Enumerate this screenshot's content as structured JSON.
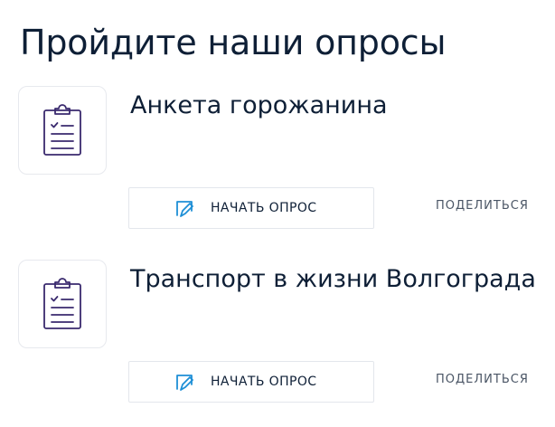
{
  "page": {
    "title": "Пройдите наши опросы"
  },
  "surveys": [
    {
      "title": "Анкета горожанина",
      "icon": "clipboard-checklist-icon",
      "start_label": "НАЧАТЬ ОПРОС",
      "start_icon": "survey-edit-icon",
      "share_label": "ПОДЕЛИТЬСЯ"
    },
    {
      "title": "Транспорт в жизни Волгограда",
      "icon": "clipboard-checklist-icon",
      "start_label": "НАЧАТЬ ОПРОС",
      "start_icon": "survey-edit-icon",
      "share_label": "ПОДЕЛИТЬСЯ"
    }
  ],
  "colors": {
    "text": "#0e1f36",
    "icon_purple": "#3a2a6e",
    "icon_blue": "#1e8fd6",
    "border": "#e3e6ec",
    "muted": "#4a5565"
  }
}
